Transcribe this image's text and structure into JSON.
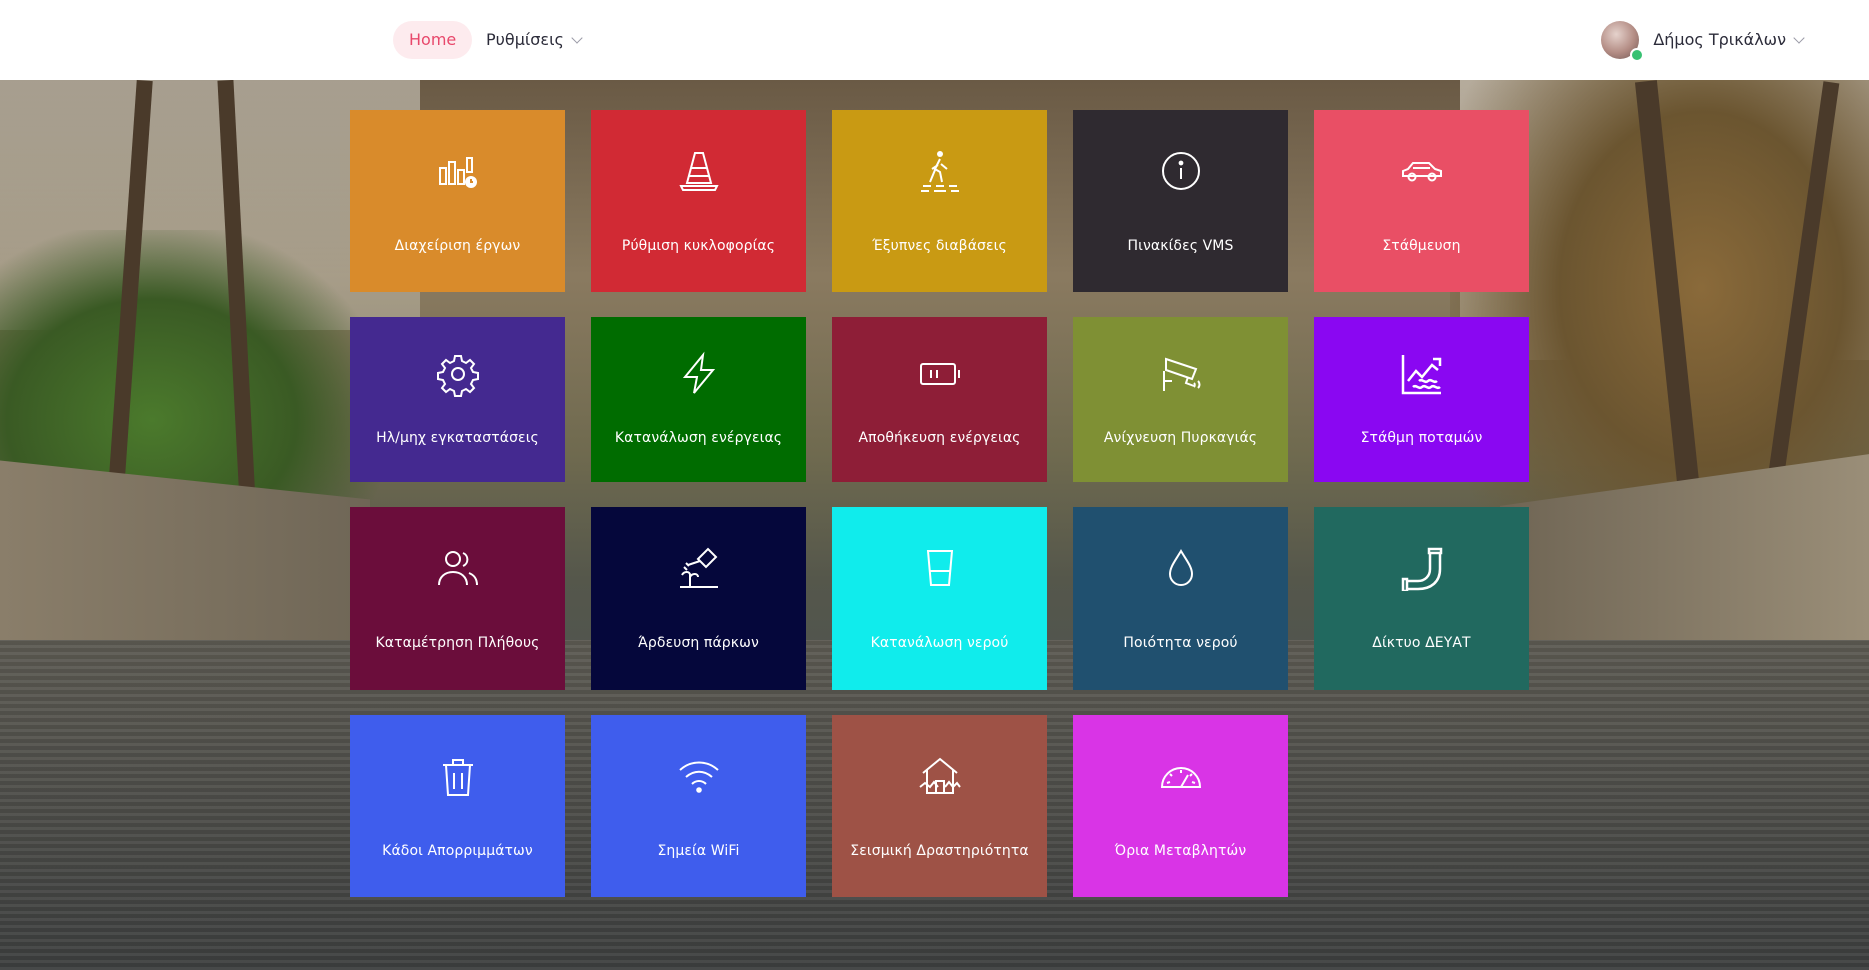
{
  "header": {
    "nav": {
      "home_label": "Home",
      "settings_label": "Ρυθμίσεις"
    },
    "user": {
      "name": "Δήμος Τρικάλων"
    }
  },
  "colors": {
    "nav_active_bg": "#fdebee",
    "nav_active_text": "#e8486b"
  },
  "tiles": [
    {
      "label": "Διαχείριση έργων",
      "icon": "bar-chart-clock-icon",
      "color": "#d98b2b"
    },
    {
      "label": "Ρύθμιση κυκλοφορίας",
      "icon": "traffic-cone-icon",
      "color": "#d12a34"
    },
    {
      "label": "Έξυπνες διαβάσεις",
      "icon": "pedestrian-crossing-icon",
      "color": "#c99a13"
    },
    {
      "label": "Πινακίδες VMS",
      "icon": "info-circle-icon",
      "color": "#2f2a30"
    },
    {
      "label": "Στάθμευση",
      "icon": "car-icon",
      "color": "#e94f65"
    },
    {
      "label": "Ηλ/μηχ εγκαταστάσεις",
      "icon": "gear-icon",
      "color": "#442990"
    },
    {
      "label": "Κατανάλωση ενέργειας",
      "icon": "lightning-icon",
      "color": "#006c00"
    },
    {
      "label": "Αποθήκευση ενέργειας",
      "icon": "battery-icon",
      "color": "#8e1e37"
    },
    {
      "label": "Ανίχνευση Πυρκαγιάς",
      "icon": "security-camera-icon",
      "color": "#7f9034"
    },
    {
      "label": "Στάθμη ποταμών",
      "icon": "river-level-chart-icon",
      "color": "#8a07f2"
    },
    {
      "label": "Καταμέτρηση Πλήθους",
      "icon": "people-icon",
      "color": "#6b0d3b"
    },
    {
      "label": "Άρδευση πάρκων",
      "icon": "watering-can-icon",
      "color": "#05073b"
    },
    {
      "label": "Κατανάλωση νερού",
      "icon": "water-glass-icon",
      "color": "#10ecec"
    },
    {
      "label": "Ποιότητα νερού",
      "icon": "water-drop-icon",
      "color": "#20506f"
    },
    {
      "label": "Δίκτυο ΔΕΥΑΤ",
      "icon": "pipe-icon",
      "color": "#21695f"
    },
    {
      "label": "Κάδοι Απορριμμάτων",
      "icon": "trash-bin-icon",
      "color": "#3f5ded"
    },
    {
      "label": "Σημεία WiFi",
      "icon": "wifi-icon",
      "color": "#3f5ded"
    },
    {
      "label": "Σεισμική Δραστηριότητα",
      "icon": "earthquake-house-icon",
      "color": "#9e5246"
    },
    {
      "label": "Όρια Μεταβλητών",
      "icon": "gauge-icon",
      "color": "#d934e6"
    }
  ]
}
